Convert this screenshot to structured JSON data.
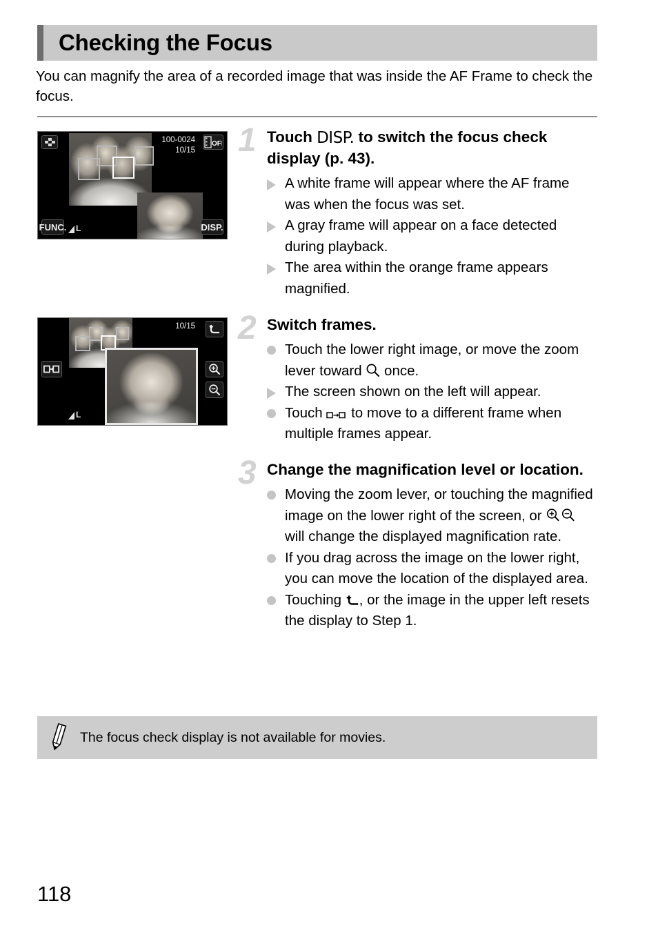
{
  "header": {
    "title": "Checking the Focus",
    "accent_color": "#6d6d6d",
    "background_color": "#c9c9c9"
  },
  "intro": "You can magnify the area of a recorded image that was inside the AF Frame to check the focus.",
  "screens": [
    {
      "name": "focus-check-overview-screen",
      "file_number": "100-0024",
      "frame_counter": "10/15",
      "movie_icon_label": "OFF",
      "func_label": "FUNC.",
      "disp_label": "DISP.",
      "quality_label": "L",
      "index_icon": "index-grid-icon"
    },
    {
      "name": "focus-check-magnified-screen",
      "frame_counter": "10/15",
      "quality_label": "L",
      "back_icon": "back-arrow-icon",
      "zoom_in_icon": "magnify-plus-icon",
      "zoom_out_icon": "magnify-minus-icon",
      "switch_frame_icon": "switch-frame-icon"
    }
  ],
  "steps": [
    {
      "number": "1",
      "heading_before": "Touch ",
      "heading_icon": "DISP.",
      "heading_after": " to switch the focus check display (p. 43).",
      "bullets": [
        {
          "mark": "triangle",
          "text": "A white frame will appear where the AF frame was when the focus was set."
        },
        {
          "mark": "triangle",
          "text": "A gray frame will appear on a face detected during playback."
        },
        {
          "mark": "triangle",
          "text": "The area within the orange frame appears magnified."
        }
      ]
    },
    {
      "number": "2",
      "heading": "Switch frames.",
      "bullets": [
        {
          "mark": "dot",
          "text_before": "Touch the lower right image, or move the zoom lever toward ",
          "icon": "magnifier-icon",
          "text_after": " once."
        },
        {
          "mark": "triangle",
          "text": "The screen shown on the left will appear."
        },
        {
          "mark": "dot",
          "text_before": "Touch ",
          "icon": "switch-frame-icon",
          "text_after": " to move to a different frame when multiple frames appear."
        }
      ]
    },
    {
      "number": "3",
      "heading": "Change the magnification level or location.",
      "bullets": [
        {
          "mark": "dot",
          "text_before": "Moving the zoom lever, or touching the magnified image on the lower right of the screen, or ",
          "icon": "magnify-plus-minus-icon",
          "text_after": " will change the displayed magnification rate."
        },
        {
          "mark": "dot",
          "text": "If you drag across the image on the lower right, you can move the location of the displayed area."
        },
        {
          "mark": "dot",
          "text_before": "Touching ",
          "icon": "back-arrow-icon",
          "text_after": ", or the image in the upper left resets the display to Step 1."
        }
      ]
    }
  ],
  "note": {
    "icon": "pencil-icon",
    "text": "The focus check display is not available for movies.",
    "background_color": "#cdcdcd"
  },
  "page_number": "118"
}
